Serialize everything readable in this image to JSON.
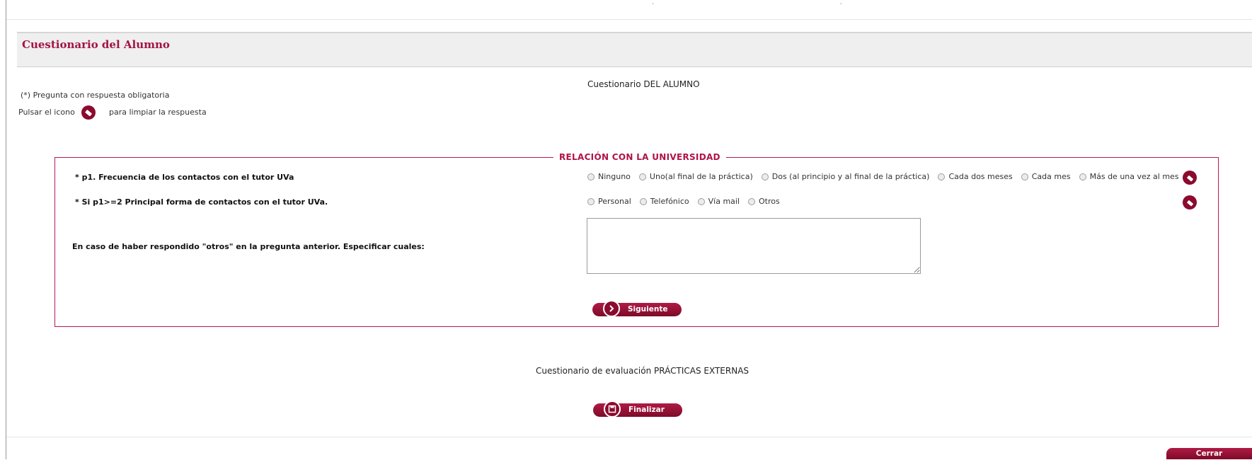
{
  "header": {
    "title": "Cuestionario del Alumno"
  },
  "intro": {
    "required_note": "(*) Pregunta con respuesta obligatoria",
    "clear_hint_before": "Pulsar el icono",
    "clear_hint_after": "para limpiar la respuesta",
    "questionnaire_title": "Cuestionario DEL ALUMNO"
  },
  "section": {
    "legend": "RELACIÓN CON LA UNIVERSIDAD",
    "questions": [
      {
        "label": "* p1. Frecuencia de los contactos con el tutor UVa",
        "options": [
          "Ninguno",
          "Uno(al final de la práctica)",
          "Dos (al principio y al final de la práctica)",
          "Cada dos meses",
          "Cada mes",
          "Más de una vez al mes"
        ]
      },
      {
        "label": "* Si p1>=2 Principal forma de contactos con el tutor UVa.",
        "options": [
          "Personal",
          "Telefónico",
          "Vía mail",
          "Otros"
        ]
      },
      {
        "label": "En caso de haber respondido \"otros\" en la pregunta anterior. Especificar cuales:",
        "value": ""
      }
    ],
    "next_button": "Siguiente"
  },
  "footer": {
    "evaluation_title": "Cuestionario de evaluación PRÁCTICAS EXTERNAS",
    "finish_button": "Finalizar",
    "close_button": "Cerrar"
  },
  "icons": {
    "clear": "eraser-icon",
    "next": "chevron-right-icon",
    "finish": "save-icon"
  },
  "colors": {
    "brand": "#8b0a2e",
    "title": "#a31442",
    "border": "#b8175a"
  }
}
